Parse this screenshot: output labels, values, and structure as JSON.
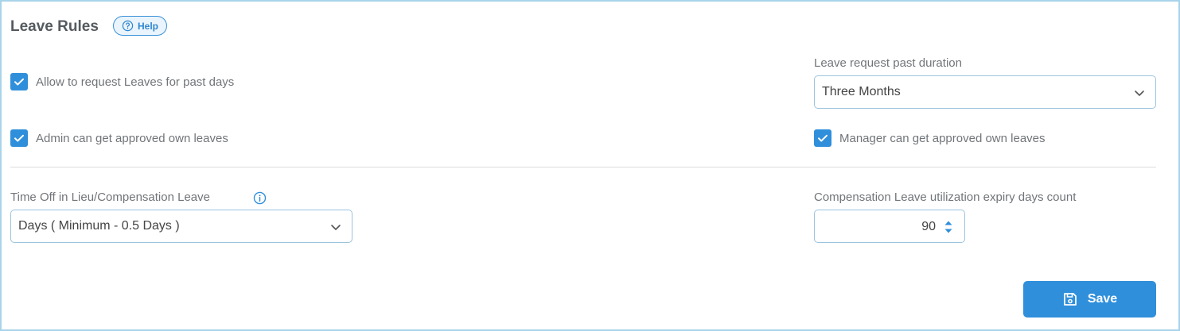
{
  "header": {
    "title": "Leave Rules",
    "help_label": "Help",
    "help_icon": "question-circle-icon"
  },
  "options": {
    "allow_past": {
      "label": "Allow to request Leaves for past days",
      "checked": true
    },
    "admin_approve": {
      "label": "Admin can get approved own leaves",
      "checked": true
    },
    "manager_approve": {
      "label": "Manager can get approved own leaves",
      "checked": true
    }
  },
  "past_duration": {
    "label": "Leave request past duration",
    "value": "Three Months"
  },
  "toil": {
    "label": "Time Off in Lieu/Compensation Leave",
    "info_icon": "info-circle-icon",
    "value": "Days ( Minimum - 0.5 Days )"
  },
  "expiry": {
    "label": "Compensation Leave utilization expiry days count",
    "value": "90"
  },
  "actions": {
    "save_label": "Save",
    "save_icon": "floppy-disk-icon"
  },
  "colors": {
    "accent": "#2f8fdb",
    "frame_border": "#a9d3e9",
    "text": "#717579"
  }
}
